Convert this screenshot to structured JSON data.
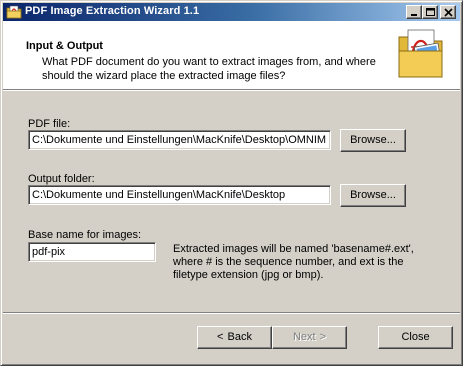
{
  "window": {
    "title": "PDF Image Extraction Wizard 1.1"
  },
  "header": {
    "title": "Input & Output",
    "description": "What PDF document do you want to extract images from, and where\nshould the wizard place the extracted image files?"
  },
  "form": {
    "pdf_file_label": "PDF file:",
    "pdf_file_value": "C:\\Dokumente und Einstellungen\\MacKnife\\Desktop\\OMNIM",
    "output_folder_label": "Output folder:",
    "output_folder_value": "C:\\Dokumente und Einstellungen\\MacKnife\\Desktop",
    "browse_label": "Browse...",
    "base_name_label": "Base name for images:",
    "base_name_value": "pdf-pix",
    "info_text": "Extracted images will be named 'basename#.ext',\nwhere # is the sequence number, and ext is the\nfiletype extension (jpg or bmp)."
  },
  "footer": {
    "back_label": "Back",
    "back_arrow": "<",
    "next_label": "Next",
    "next_arrow": ">",
    "next_disabled": true,
    "close_label": "Close"
  },
  "colors": {
    "face": "#d4d0c8",
    "title_start": "#0a246a",
    "title_end": "#a6caf0"
  },
  "icons": [
    "app-pdf-icon",
    "minimize-icon",
    "maximize-icon",
    "close-icon",
    "header-images-folder-icon"
  ]
}
